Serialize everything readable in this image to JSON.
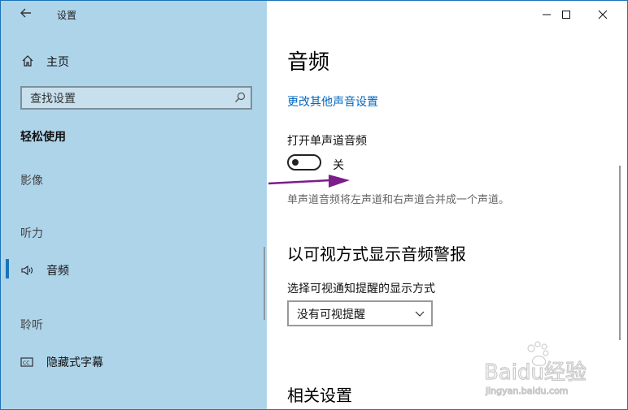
{
  "window": {
    "title": "设置",
    "controls": [
      "minimize",
      "maximize",
      "close"
    ]
  },
  "sidebar": {
    "home_label": "主页",
    "search_placeholder": "查找设置",
    "section_title": "轻松使用",
    "categories": [
      {
        "label": "影像"
      },
      {
        "label": "听力"
      },
      {
        "label": "聆听"
      }
    ],
    "items": [
      {
        "label": "音频",
        "icon": "speaker-icon",
        "active": true
      },
      {
        "label": "隐藏式字幕",
        "icon": "closed-captions-icon",
        "active": false
      }
    ]
  },
  "main": {
    "title": "音频",
    "link": "更改其他声音设置",
    "mono_audio": {
      "label": "打开单声道音频",
      "state_text": "关",
      "on": false,
      "description": "单声道音频将左声道和右声道合并成一个声道。"
    },
    "visual_alerts": {
      "heading": "以可视方式显示音频警报",
      "select_label": "选择可视通知提醒的显示方式",
      "select_value": "没有可视提醒"
    },
    "related_heading": "相关设置"
  },
  "watermark": {
    "brand": "Baidu经验",
    "site": "jingyan.baidu.com"
  },
  "colors": {
    "sidebar_bg": "#aed4ea",
    "accent": "#1a73b8",
    "link": "#0067c0",
    "arrow": "#7b1e8c"
  }
}
